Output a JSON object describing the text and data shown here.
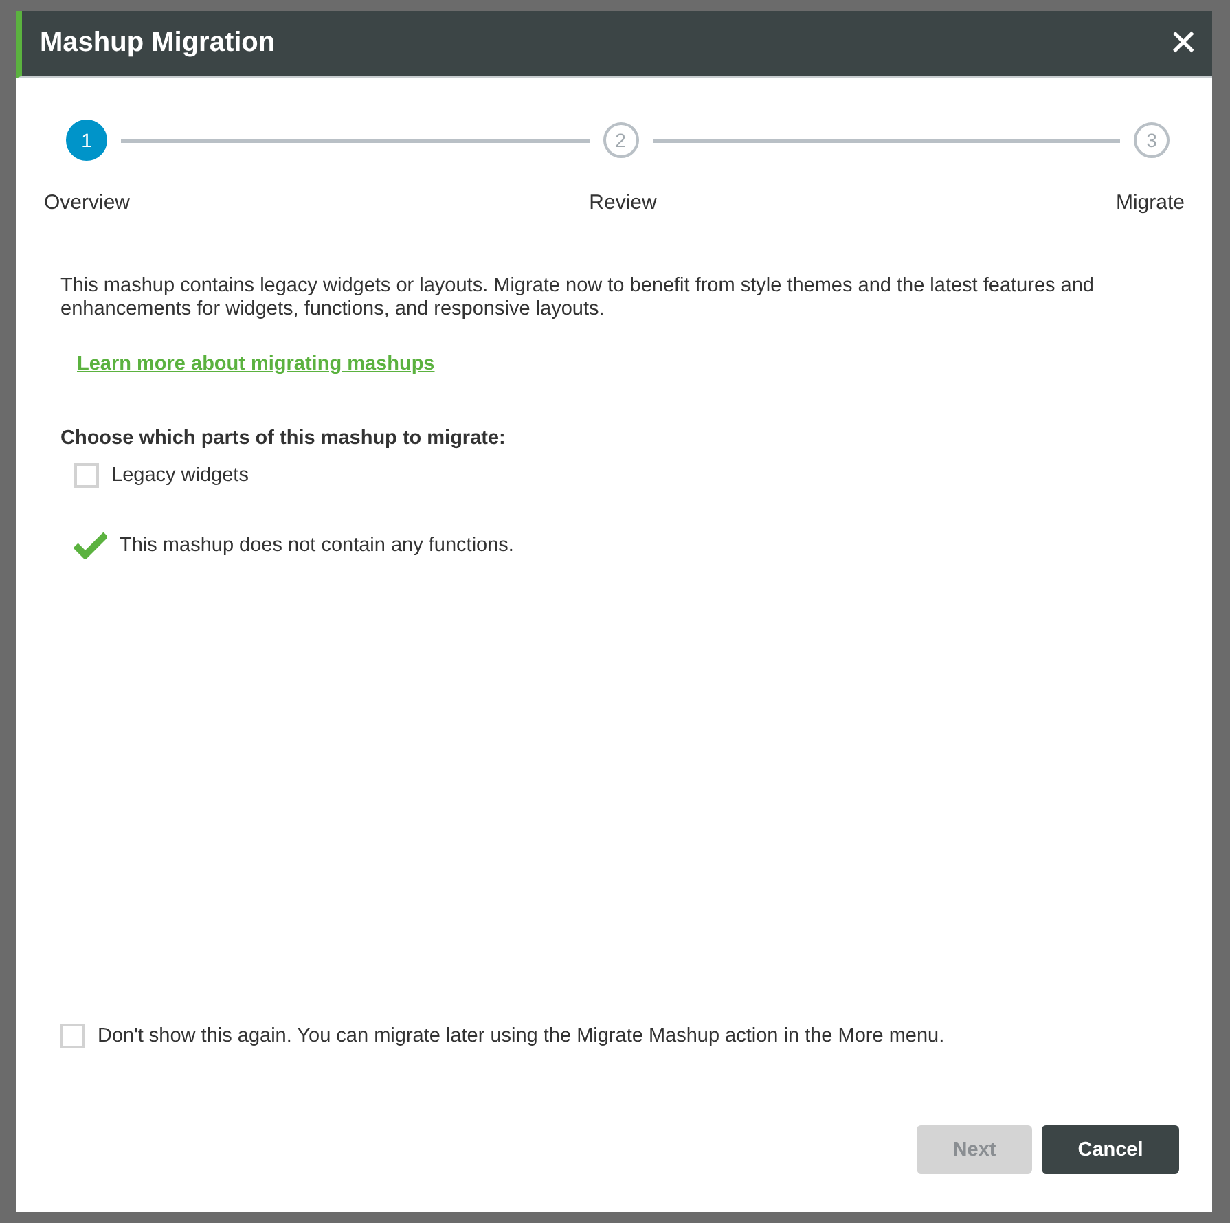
{
  "dialog": {
    "title": "Mashup Migration",
    "close": "✕",
    "steps": [
      {
        "number": "1",
        "label": "Overview",
        "selected": true
      },
      {
        "number": "2",
        "label": "Review",
        "selected": false
      },
      {
        "number": "3",
        "label": "Migrate",
        "selected": false
      }
    ],
    "intro": "This mashup contains legacy widgets or layouts. Migrate now to benefit from style themes and the latest features and enhancements for widgets, functions, and responsive layouts.",
    "link": "Learn more about migrating mashups",
    "choose_heading": "Choose which parts of this mashup to migrate:",
    "options": [
      {
        "kind": "checkbox",
        "label": "Legacy widgets",
        "checked": false
      },
      {
        "kind": "notice",
        "label": "This mashup does not contain any functions."
      }
    ],
    "dont_show": {
      "label": "Don't show this again. You can migrate later using the Migrate Mashup action in the More menu.",
      "checked": false
    },
    "buttons": [
      {
        "label": "Next",
        "disabled": true
      },
      {
        "label": "Cancel",
        "disabled": false
      }
    ]
  }
}
